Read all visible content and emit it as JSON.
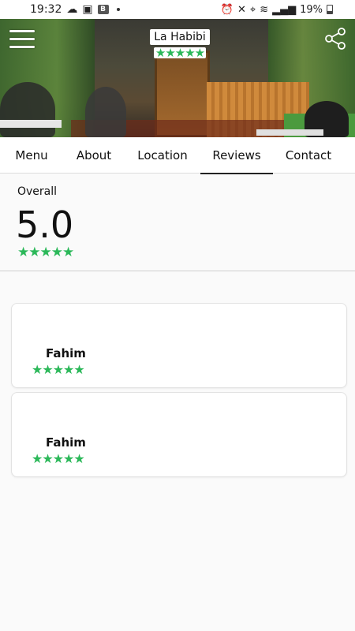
{
  "status_bar": {
    "time": "19:32",
    "battery": "19%"
  },
  "header": {
    "restaurant_name": "La Habibi",
    "rating_stars": 5,
    "star_color": "#2bb859",
    "menu_icon": "hamburger-menu-icon",
    "share_icon": "share-icon"
  },
  "tabs": [
    {
      "label": "Menu"
    },
    {
      "label": "About"
    },
    {
      "label": "Location"
    },
    {
      "label": "Reviews",
      "active": true
    },
    {
      "label": "Contact"
    }
  ],
  "overall": {
    "label": "Overall",
    "score": "5.0",
    "stars": 5
  },
  "reviews": [
    {
      "name": "Fahim",
      "stars": 5
    },
    {
      "name": "Fahim",
      "stars": 5
    }
  ]
}
